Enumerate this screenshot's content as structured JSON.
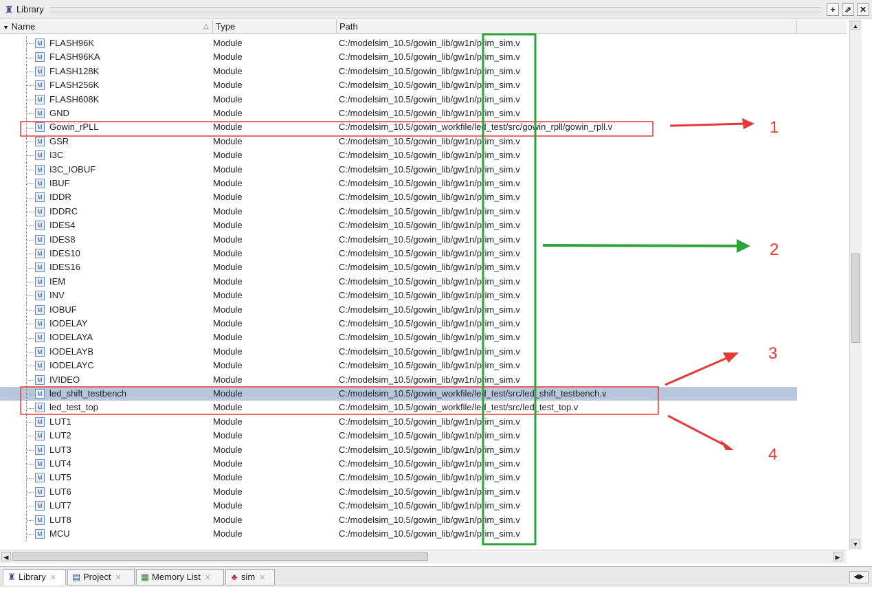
{
  "window": {
    "title": "Library",
    "icons": {
      "title": "library-icon",
      "add": "plus-icon",
      "undock": "undock-icon",
      "close": "close-icon"
    }
  },
  "columns": {
    "name": "Name",
    "type": "Type",
    "path": "Path"
  },
  "rows": [
    {
      "name": "FLASH96K",
      "type": "Module",
      "path": "C:/modelsim_10.5/gowin_lib/gw1n/prim_sim.v"
    },
    {
      "name": "FLASH96KA",
      "type": "Module",
      "path": "C:/modelsim_10.5/gowin_lib/gw1n/prim_sim.v"
    },
    {
      "name": "FLASH128K",
      "type": "Module",
      "path": "C:/modelsim_10.5/gowin_lib/gw1n/prim_sim.v"
    },
    {
      "name": "FLASH256K",
      "type": "Module",
      "path": "C:/modelsim_10.5/gowin_lib/gw1n/prim_sim.v"
    },
    {
      "name": "FLASH608K",
      "type": "Module",
      "path": "C:/modelsim_10.5/gowin_lib/gw1n/prim_sim.v"
    },
    {
      "name": "GND",
      "type": "Module",
      "path": "C:/modelsim_10.5/gowin_lib/gw1n/prim_sim.v"
    },
    {
      "name": "Gowin_rPLL",
      "type": "Module",
      "path": "C:/modelsim_10.5/gowin_workfile/led_test/src/gowin_rpll/gowin_rpll.v"
    },
    {
      "name": "GSR",
      "type": "Module",
      "path": "C:/modelsim_10.5/gowin_lib/gw1n/prim_sim.v"
    },
    {
      "name": "I3C",
      "type": "Module",
      "path": "C:/modelsim_10.5/gowin_lib/gw1n/prim_sim.v"
    },
    {
      "name": "I3C_IOBUF",
      "type": "Module",
      "path": "C:/modelsim_10.5/gowin_lib/gw1n/prim_sim.v"
    },
    {
      "name": "IBUF",
      "type": "Module",
      "path": "C:/modelsim_10.5/gowin_lib/gw1n/prim_sim.v"
    },
    {
      "name": "IDDR",
      "type": "Module",
      "path": "C:/modelsim_10.5/gowin_lib/gw1n/prim_sim.v"
    },
    {
      "name": "IDDRC",
      "type": "Module",
      "path": "C:/modelsim_10.5/gowin_lib/gw1n/prim_sim.v"
    },
    {
      "name": "IDES4",
      "type": "Module",
      "path": "C:/modelsim_10.5/gowin_lib/gw1n/prim_sim.v"
    },
    {
      "name": "IDES8",
      "type": "Module",
      "path": "C:/modelsim_10.5/gowin_lib/gw1n/prim_sim.v"
    },
    {
      "name": "IDES10",
      "type": "Module",
      "path": "C:/modelsim_10.5/gowin_lib/gw1n/prim_sim.v"
    },
    {
      "name": "IDES16",
      "type": "Module",
      "path": "C:/modelsim_10.5/gowin_lib/gw1n/prim_sim.v"
    },
    {
      "name": "IEM",
      "type": "Module",
      "path": "C:/modelsim_10.5/gowin_lib/gw1n/prim_sim.v"
    },
    {
      "name": "INV",
      "type": "Module",
      "path": "C:/modelsim_10.5/gowin_lib/gw1n/prim_sim.v"
    },
    {
      "name": "IOBUF",
      "type": "Module",
      "path": "C:/modelsim_10.5/gowin_lib/gw1n/prim_sim.v"
    },
    {
      "name": "IODELAY",
      "type": "Module",
      "path": "C:/modelsim_10.5/gowin_lib/gw1n/prim_sim.v"
    },
    {
      "name": "IODELAYA",
      "type": "Module",
      "path": "C:/modelsim_10.5/gowin_lib/gw1n/prim_sim.v"
    },
    {
      "name": "IODELAYB",
      "type": "Module",
      "path": "C:/modelsim_10.5/gowin_lib/gw1n/prim_sim.v"
    },
    {
      "name": "IODELAYC",
      "type": "Module",
      "path": "C:/modelsim_10.5/gowin_lib/gw1n/prim_sim.v"
    },
    {
      "name": "IVIDEO",
      "type": "Module",
      "path": "C:/modelsim_10.5/gowin_lib/gw1n/prim_sim.v"
    },
    {
      "name": "led_shift_testbench",
      "type": "Module",
      "path": "C:/modelsim_10.5/gowin_workfile/led_test/src/led_shift_testbench.v",
      "selected": true
    },
    {
      "name": "led_test_top",
      "type": "Module",
      "path": "C:/modelsim_10.5/gowin_workfile/led_test/src/led_test_top.v"
    },
    {
      "name": "LUT1",
      "type": "Module",
      "path": "C:/modelsim_10.5/gowin_lib/gw1n/prim_sim.v"
    },
    {
      "name": "LUT2",
      "type": "Module",
      "path": "C:/modelsim_10.5/gowin_lib/gw1n/prim_sim.v"
    },
    {
      "name": "LUT3",
      "type": "Module",
      "path": "C:/modelsim_10.5/gowin_lib/gw1n/prim_sim.v"
    },
    {
      "name": "LUT4",
      "type": "Module",
      "path": "C:/modelsim_10.5/gowin_lib/gw1n/prim_sim.v"
    },
    {
      "name": "LUT5",
      "type": "Module",
      "path": "C:/modelsim_10.5/gowin_lib/gw1n/prim_sim.v"
    },
    {
      "name": "LUT6",
      "type": "Module",
      "path": "C:/modelsim_10.5/gowin_lib/gw1n/prim_sim.v"
    },
    {
      "name": "LUT7",
      "type": "Module",
      "path": "C:/modelsim_10.5/gowin_lib/gw1n/prim_sim.v"
    },
    {
      "name": "LUT8",
      "type": "Module",
      "path": "C:/modelsim_10.5/gowin_lib/gw1n/prim_sim.v"
    },
    {
      "name": "MCU",
      "type": "Module",
      "path": "C:/modelsim_10.5/gowin_lib/gw1n/prim_sim.v"
    }
  ],
  "tabs": [
    {
      "label": "Library",
      "icon": "library-icon",
      "active": true
    },
    {
      "label": "Project",
      "icon": "project-icon"
    },
    {
      "label": "Memory List",
      "icon": "memory-icon"
    },
    {
      "label": "sim",
      "icon": "sim-icon"
    }
  ],
  "annotations": {
    "labels": [
      "1",
      "2",
      "3",
      "4"
    ],
    "colors": {
      "red": "#e53935",
      "green": "#2ea33a",
      "selection": "#b8c7dc"
    }
  }
}
